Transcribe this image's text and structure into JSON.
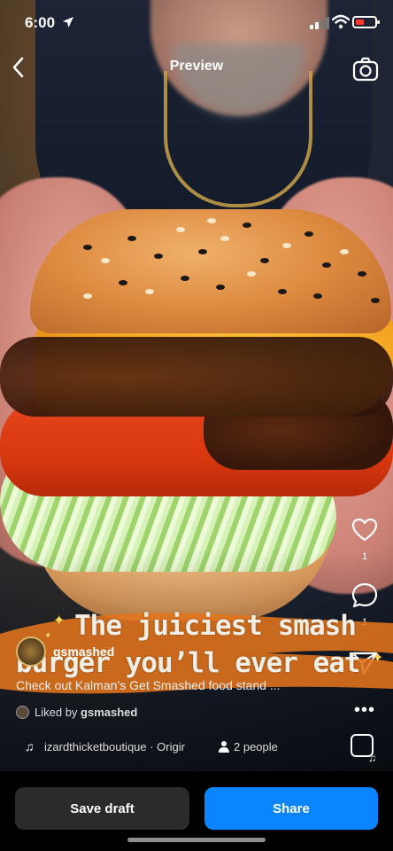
{
  "status_bar": {
    "time": "6:00"
  },
  "header": {
    "title": "Preview"
  },
  "overlay_text": {
    "line1": "The juiciest smash",
    "line2": "burger you’ll ever eat"
  },
  "post": {
    "username": "gsmashed",
    "caption": "Check out Kalman’s Get Smashed food stand ...",
    "liked_by_prefix": "Liked by ",
    "liked_by_user": "gsmashed",
    "audio": "izardthicketboutique · Origir",
    "people": "2 people"
  },
  "actions": {
    "likes": "1",
    "comments": "1"
  },
  "bottom_bar": {
    "save_draft": "Save draft",
    "share": "Share"
  },
  "colors": {
    "share_button": "#0a84ff",
    "draft_button": "#2b2b2b",
    "battery_low": "#ff3b30"
  }
}
